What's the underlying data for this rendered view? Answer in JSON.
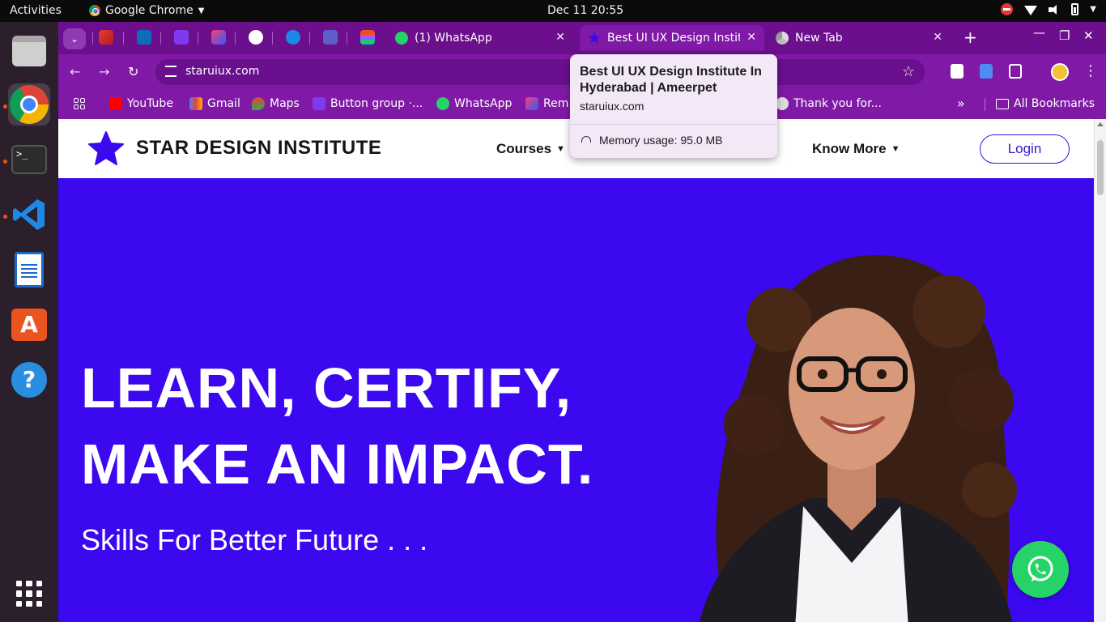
{
  "os": {
    "activities": "Activities",
    "app_name": "Google Chrome",
    "clock": "Dec 11  20:55"
  },
  "tabs": [
    {
      "title": "(1) WhatsApp",
      "favicon": "whatsapp-icon"
    },
    {
      "title": "Best UI UX Design Institu",
      "favicon": "star-icon",
      "active": true
    },
    {
      "title": "New Tab",
      "favicon": "chrome-icon"
    }
  ],
  "toolbar": {
    "url": "staruiux.com"
  },
  "bookmarks": [
    {
      "label": "YouTube",
      "icon": "youtube-icon"
    },
    {
      "label": "Gmail",
      "icon": "gmail-icon"
    },
    {
      "label": "Maps",
      "icon": "maps-icon"
    },
    {
      "label": "Button group ·...",
      "icon": "bootstrap-icon"
    },
    {
      "label": "WhatsApp",
      "icon": "whatsapp-icon"
    },
    {
      "label": "Rem",
      "icon": "flag-icon"
    },
    {
      "label": "Thank you for...",
      "icon": "chrome-icon"
    }
  ],
  "bookmarks_all": "All Bookmarks",
  "hovercard": {
    "title": "Best UI UX Design Institute In Hyderabad | Ameerpet",
    "url": "staruiux.com",
    "memory": "Memory usage: 95.0 MB"
  },
  "site": {
    "brand": "STAR DESIGN INSTITUTE",
    "nav_courses": "Courses",
    "nav_know_more": "Know More",
    "login": "Login",
    "headline_1": "LEARN, CERTIFY,",
    "headline_2": "MAKE AN IMPACT.",
    "tagline": "Skills For Better Future . . ."
  },
  "colors": {
    "hero_bg": "#3b08f0",
    "chrome_frame": "#8019a6",
    "whatsapp": "#25d366"
  }
}
